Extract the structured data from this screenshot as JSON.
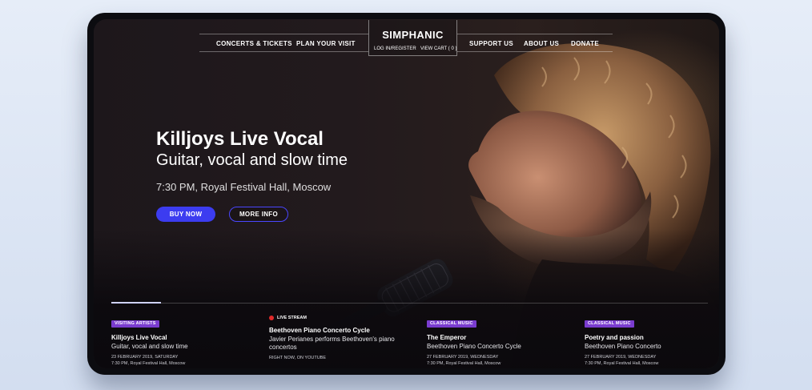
{
  "nav": {
    "left_items": [
      {
        "label": "CONCERTS & TICKETS"
      },
      {
        "label": "PLAN YOUR VISIT"
      }
    ],
    "right_items": [
      {
        "label": "SUPPORT US"
      },
      {
        "label": "ABOUT US"
      },
      {
        "label": "DONATE"
      }
    ],
    "brand": "SIMPHANIC",
    "login": "LOG IN/REGISTER",
    "cart": "VIEW CART ( 0 )"
  },
  "hero": {
    "title": "Killjoys Live Vocal",
    "subtitle": "Guitar, vocal and slow time",
    "meta": "7:30 PM, Royal Festival Hall, Moscow",
    "buy_label": "BUY NOW",
    "info_label": "MORE INFO"
  },
  "events": [
    {
      "tag": "VISITING ARTISTS",
      "title": "Killjoys Live Vocal",
      "desc": "Guitar, vocal and slow time",
      "date": "23 FEBRUARY 2019, SATURDAY",
      "place": "7:30 PM, Royal Festival Hall, Moscow"
    },
    {
      "tag": "LIVE STREAM",
      "title": "Beethoven Piano Concerto Cycle",
      "desc": "Javier Perianes performs Beethoven's piano concertos",
      "date": "RIGHT NOW, ON YOUTUBE",
      "place": ""
    },
    {
      "tag": "CLASSICAL MUSIC",
      "title": "The Emperor",
      "desc": "Beethoven Piano Concerto Cycle",
      "date": "27 FEBRUARY 2019, WEDNESDAY",
      "place": "7:30 PM, Royal Festival Hall, Moscow"
    },
    {
      "tag": "CLASSICAL MUSIC",
      "title": "Poetry and passion",
      "desc": "Beethoven Piano Concerto",
      "date": "27 FEBRUARY 2019, WEDNESDAY",
      "place": "7:30 PM, Royal Festival Hall, Moscow"
    }
  ],
  "colors": {
    "accent": "#3c3cf0",
    "tag": "#7a3ccf",
    "live": "#e02a2a"
  }
}
